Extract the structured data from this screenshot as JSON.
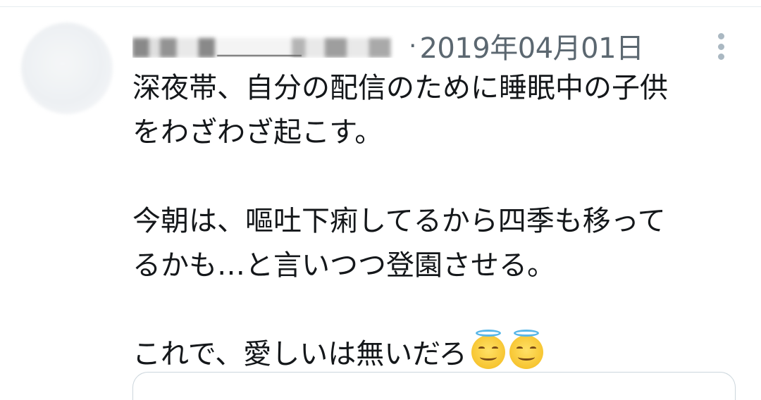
{
  "tweet": {
    "user_name": "＿＿＿＿",
    "separator": "·",
    "date": "2019年04月01日",
    "more_icon": "more-vertical-icon",
    "lines": [
      "深夜帯、自分の配信のために睡眠中の子供",
      "をわざわざ起こす。",
      "",
      "今朝は、嘔吐下痢してるから四季も移って",
      "るかも…と言いつつ登園させる。",
      "",
      "これで、愛しいは無いだろ"
    ],
    "emojis": [
      "smiling-face-with-halo-icon",
      "smiling-face-with-halo-icon"
    ]
  },
  "colors": {
    "text": "#14171a",
    "secondary": "#5b6770",
    "icon_grey": "#aab8c2",
    "divider": "#e6ecf0"
  }
}
